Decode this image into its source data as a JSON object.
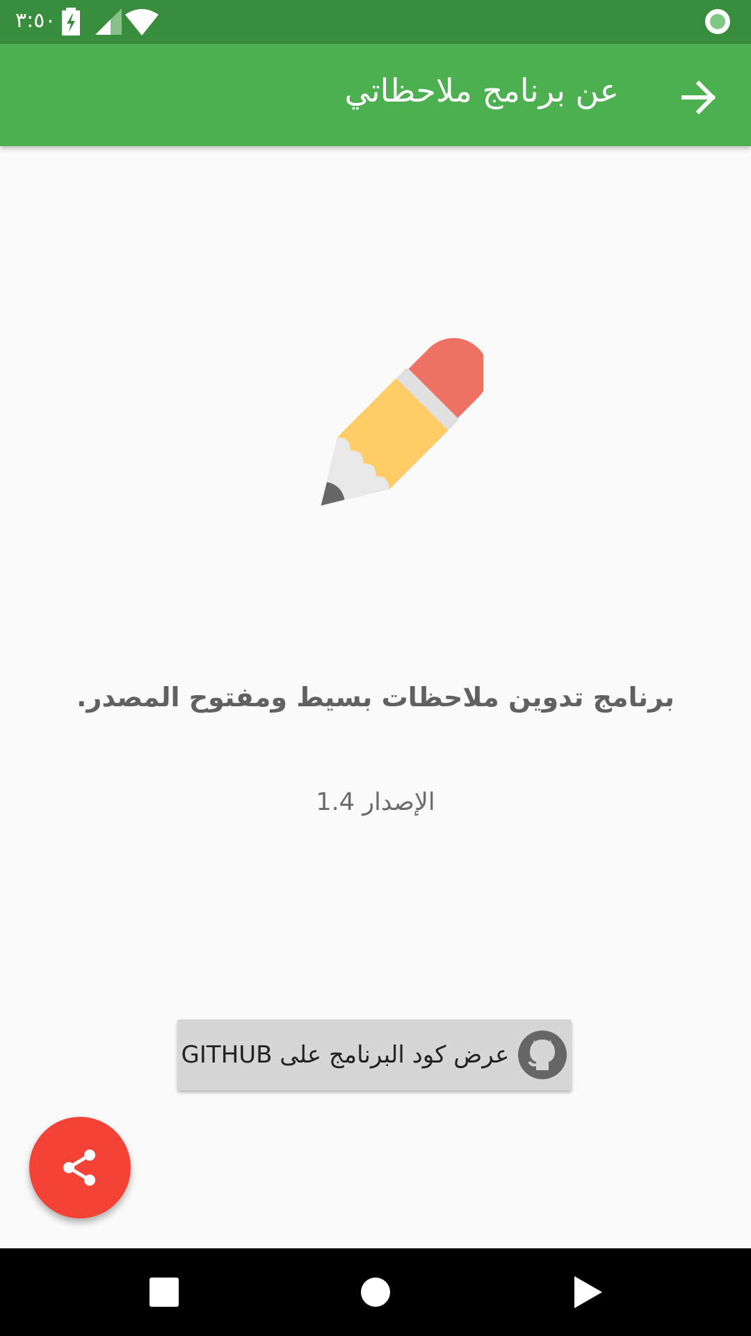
{
  "status_bar": {
    "time": "٣:٥٠",
    "icons": [
      "battery-charging-icon",
      "cell-signal-icon",
      "wifi-icon",
      "recording-dot-icon"
    ]
  },
  "app_bar": {
    "title": "عن برنامج ملاحظاتي",
    "back_icon": "arrow-back-icon",
    "color": "#4caf50"
  },
  "main": {
    "logo_icon": "pencil-icon",
    "description": "برنامج تدوين ملاحظات بسيط ومفتوح المصدر.",
    "version": "الإصدار 1.4",
    "github_button": {
      "label": "عرض كود البرنامج على GITHUB",
      "icon": "github-icon"
    }
  },
  "fab": {
    "icon": "share-icon",
    "color": "#f44336"
  },
  "nav_bar": {
    "buttons": [
      "recents-square-icon",
      "home-circle-icon",
      "back-triangle-icon"
    ]
  }
}
